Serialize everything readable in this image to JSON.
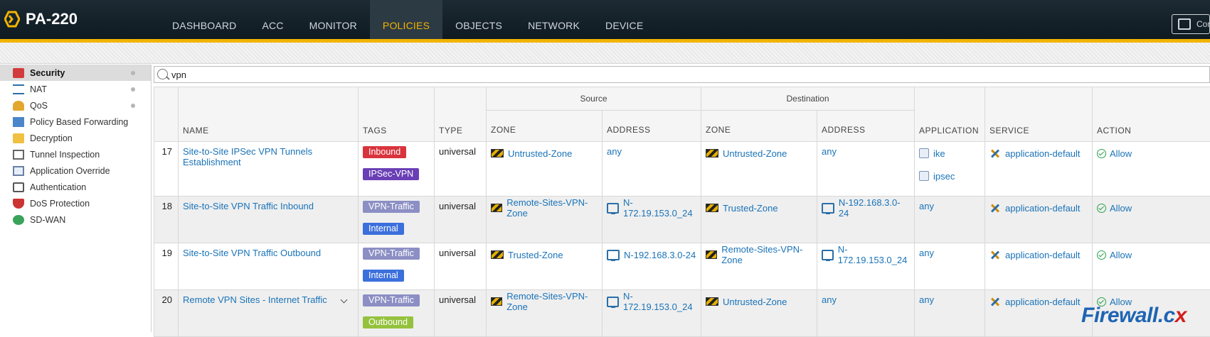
{
  "app": {
    "title": "PA-220"
  },
  "nav": {
    "tabs": [
      "DASHBOARD",
      "ACC",
      "MONITOR",
      "POLICIES",
      "OBJECTS",
      "NETWORK",
      "DEVICE"
    ],
    "active": "POLICIES",
    "commit_label": "Commit"
  },
  "sidebar": {
    "items": [
      {
        "label": "Security",
        "icon": "security-icon"
      },
      {
        "label": "NAT",
        "icon": "nat-icon"
      },
      {
        "label": "QoS",
        "icon": "qos-icon"
      },
      {
        "label": "Policy Based Forwarding",
        "icon": "pbf-icon"
      },
      {
        "label": "Decryption",
        "icon": "lock-icon"
      },
      {
        "label": "Tunnel Inspection",
        "icon": "tunnel-icon"
      },
      {
        "label": "Application Override",
        "icon": "app-override-icon"
      },
      {
        "label": "Authentication",
        "icon": "authentication-icon"
      },
      {
        "label": "DoS Protection",
        "icon": "shield-icon"
      },
      {
        "label": "SD-WAN",
        "icon": "globe-icon"
      }
    ]
  },
  "search": {
    "value": "vpn"
  },
  "table": {
    "group_headers": {
      "source": "Source",
      "destination": "Destination"
    },
    "columns": [
      "NAME",
      "TAGS",
      "TYPE",
      "ZONE",
      "ADDRESS",
      "ZONE",
      "ADDRESS",
      "APPLICATION",
      "SERVICE",
      "ACTION"
    ],
    "rows": [
      {
        "num": "17",
        "name": "Site-to-Site IPSec VPN Tunnels Establishment",
        "tags": [
          {
            "label": "Inbound",
            "color": "#d9343d"
          },
          {
            "label": "IPSec-VPN",
            "color": "#6a3fb5"
          }
        ],
        "type": "universal",
        "src_zone": "Untrusted-Zone",
        "src_addr": "any",
        "dst_zone": "Untrusted-Zone",
        "dst_addr": "any",
        "apps": [
          "ike",
          "ipsec"
        ],
        "service": "application-default",
        "action": "Allow"
      },
      {
        "num": "18",
        "name": "Site-to-Site VPN Traffic Inbound",
        "tags": [
          {
            "label": "VPN-Traffic",
            "color": "#8c8fc4"
          },
          {
            "label": "Internal",
            "color": "#3b6fdc"
          }
        ],
        "type": "universal",
        "src_zone": "Remote-Sites-VPN-Zone",
        "src_addr": "N-172.19.153.0_24",
        "dst_zone": "Trusted-Zone",
        "dst_addr": "N-192.168.3.0-24",
        "apps": [
          "any"
        ],
        "service": "application-default",
        "action": "Allow"
      },
      {
        "num": "19",
        "name": "Site-to-Site VPN Traffic Outbound",
        "tags": [
          {
            "label": "VPN-Traffic",
            "color": "#8c8fc4"
          },
          {
            "label": "Internal",
            "color": "#3b6fdc"
          }
        ],
        "type": "universal",
        "src_zone": "Trusted-Zone",
        "src_addr": "N-192.168.3.0-24",
        "dst_zone": "Remote-Sites-VPN-Zone",
        "dst_addr": "N-172.19.153.0_24",
        "apps": [
          "any"
        ],
        "service": "application-default",
        "action": "Allow"
      },
      {
        "num": "20",
        "name": "Remote VPN Sites - Internet Traffic",
        "tags": [
          {
            "label": "VPN-Traffic",
            "color": "#8c8fc4"
          },
          {
            "label": "Outbound",
            "color": "#95c23d"
          }
        ],
        "type": "universal",
        "src_zone": "Remote-Sites-VPN-Zone",
        "src_addr": "N-172.19.153.0_24",
        "dst_zone": "Untrusted-Zone",
        "dst_addr": "any",
        "apps": [
          "any"
        ],
        "service": "application-default",
        "action": "Allow"
      }
    ]
  },
  "watermark": {
    "main": "Firewall.c",
    "accent": "x"
  }
}
